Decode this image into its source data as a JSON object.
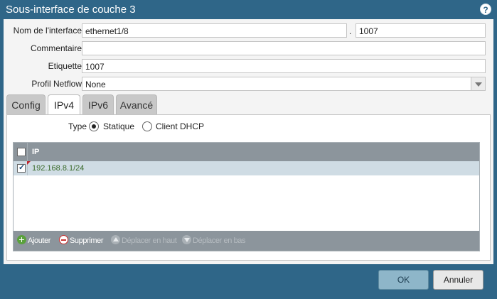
{
  "dialog": {
    "title": "Sous-interface de couche 3",
    "help_icon": "help-icon",
    "help_glyph": "?"
  },
  "form": {
    "interface_name_label": "Nom de l'interface",
    "interface_name_value": "ethernet1/8",
    "separator": ".",
    "interface_tag_value": "1007",
    "comment_label": "Commentaire",
    "comment_value": "",
    "tag_label": "Etiquette",
    "tag_value": "1007",
    "netflow_label": "Profil Netflow",
    "netflow_value": "None"
  },
  "tabs": [
    {
      "label": "Config",
      "active": false
    },
    {
      "label": "IPv4",
      "active": true
    },
    {
      "label": "IPv6",
      "active": false
    },
    {
      "label": "Avancé",
      "active": false
    }
  ],
  "ipv4": {
    "type_label": "Type",
    "option_static": "Statique",
    "option_dhcp": "Client DHCP",
    "selected": "Statique",
    "grid_header": "IP",
    "rows": [
      {
        "ip": "192.168.8.1/24",
        "checked": true
      }
    ],
    "actions": {
      "add": "Ajouter",
      "delete": "Supprimer",
      "move_up": "Déplacer en haut",
      "move_down": "Déplacer en bas"
    }
  },
  "buttons": {
    "ok": "OK",
    "cancel": "Annuler"
  },
  "colors": {
    "titlebar": "#2f6688",
    "grid_header": "#8c959c",
    "selected_row": "#cfdce4",
    "ok_button": "#8eb6c9",
    "ip_text": "#3a6a2a"
  }
}
